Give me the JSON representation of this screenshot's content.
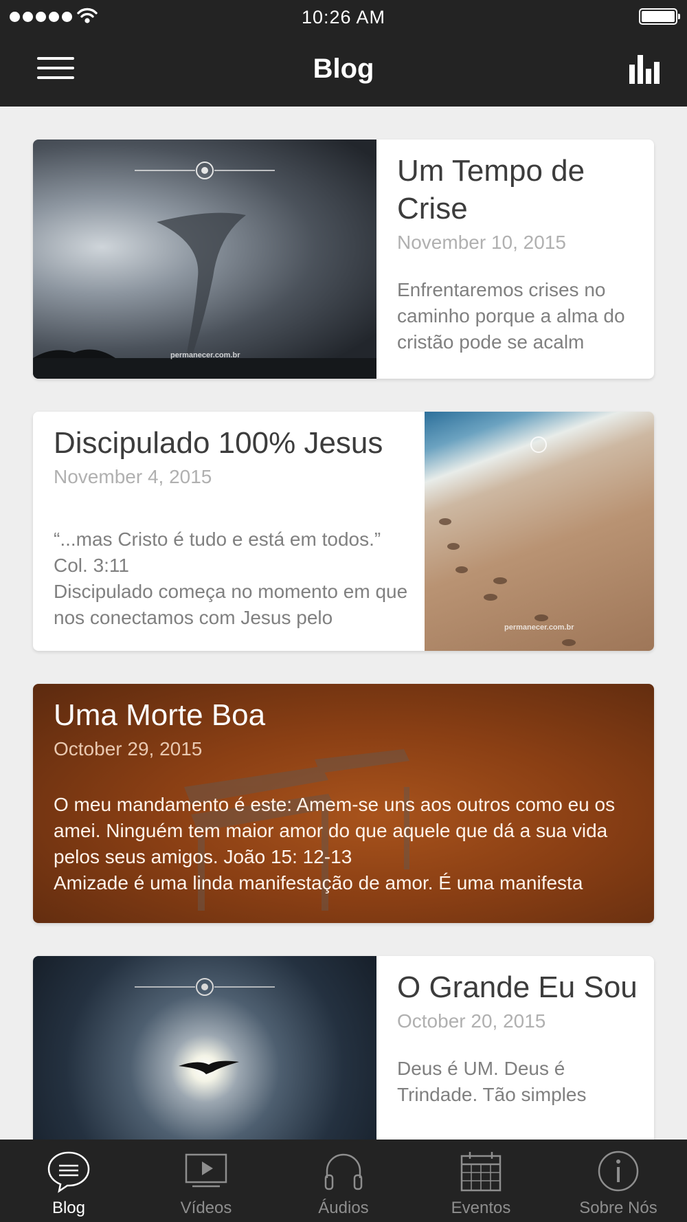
{
  "status_bar": {
    "time": "10:26 AM"
  },
  "header": {
    "title": "Blog",
    "menu_icon": "hamburger-icon",
    "stats_icon": "bar-chart-icon"
  },
  "posts": [
    {
      "title": "Um Tempo de Crise",
      "date": "November 10, 2015",
      "excerpt": "Enfrentaremos crises no caminho porque a alma do cristão pode se acalm",
      "image_watermark": "permanecer.com.br"
    },
    {
      "title": "Discipulado 100% Jesus",
      "date": "November 4, 2015",
      "excerpt": "“...mas Cristo é tudo e está em todos.”  Col. 3:11\nDiscipulado começa no momento em que nos conectamos com Jesus pelo",
      "image_watermark": "permanecer.com.br"
    },
    {
      "title": "Uma Morte Boa",
      "date": "October 29, 2015",
      "excerpt": "O meu mandamento é este: Amem-se uns aos outros como eu os amei. Ninguém tem maior amor do que aquele que dá a sua vida pelos seus amigos. João 15: 12-13\nAmizade é uma linda manifestação de amor.  É uma manifesta"
    },
    {
      "title": "O Grande Eu Sou",
      "date": "October 20, 2015",
      "excerpt": "Deus é UM.  Deus é Trindade.  Tão simples"
    }
  ],
  "tabs": [
    {
      "label": "Blog",
      "icon": "chat-bubble-icon",
      "active": true
    },
    {
      "label": "Vídeos",
      "icon": "video-play-icon",
      "active": false
    },
    {
      "label": "Áudios",
      "icon": "headphones-icon",
      "active": false
    },
    {
      "label": "Eventos",
      "icon": "calendar-icon",
      "active": false
    },
    {
      "label": "Sobre Nós",
      "icon": "info-icon",
      "active": false
    }
  ],
  "colors": {
    "bar": "#232323",
    "background": "#eeeeee",
    "active_tab": "#ffffff",
    "inactive_tab": "#8e8e8e"
  }
}
